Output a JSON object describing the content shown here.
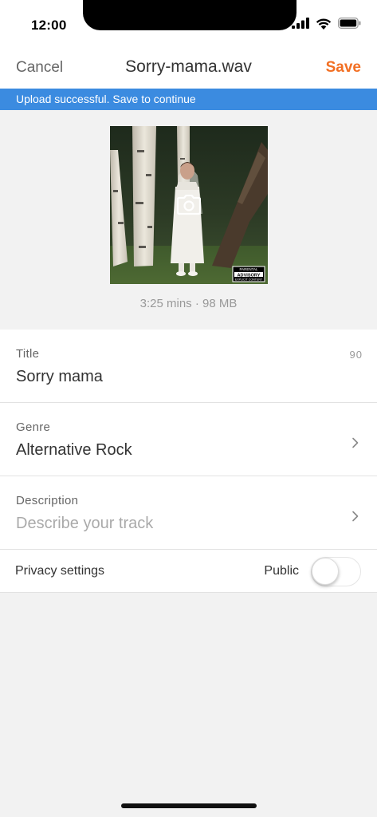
{
  "status_bar": {
    "time": "12:00",
    "icons": [
      "signal-icon",
      "wifi-icon",
      "battery-icon"
    ]
  },
  "nav": {
    "cancel_label": "Cancel",
    "title": "Sorry-mama.wav",
    "save_label": "Save"
  },
  "banner": {
    "message": "Upload successful. Save to continue"
  },
  "artwork": {
    "edit_icon": "camera-icon",
    "advisory_label": "ADVISORY",
    "advisory_top": "PARENTAL",
    "advisory_bottom": "EXPLICIT CONTENT"
  },
  "file_meta": "3:25 mins · 98 MB",
  "form": {
    "title": {
      "label": "Title",
      "value": "Sorry mama",
      "counter": "90"
    },
    "genre": {
      "label": "Genre",
      "value": "Alternative Rock"
    },
    "description": {
      "label": "Description",
      "placeholder": "Describe your track"
    },
    "privacy": {
      "label": "Privacy settings",
      "state_label": "Public",
      "enabled": false
    }
  },
  "colors": {
    "accent": "#f26f23",
    "banner": "#3b8be0",
    "background": "#f2f2f2"
  }
}
